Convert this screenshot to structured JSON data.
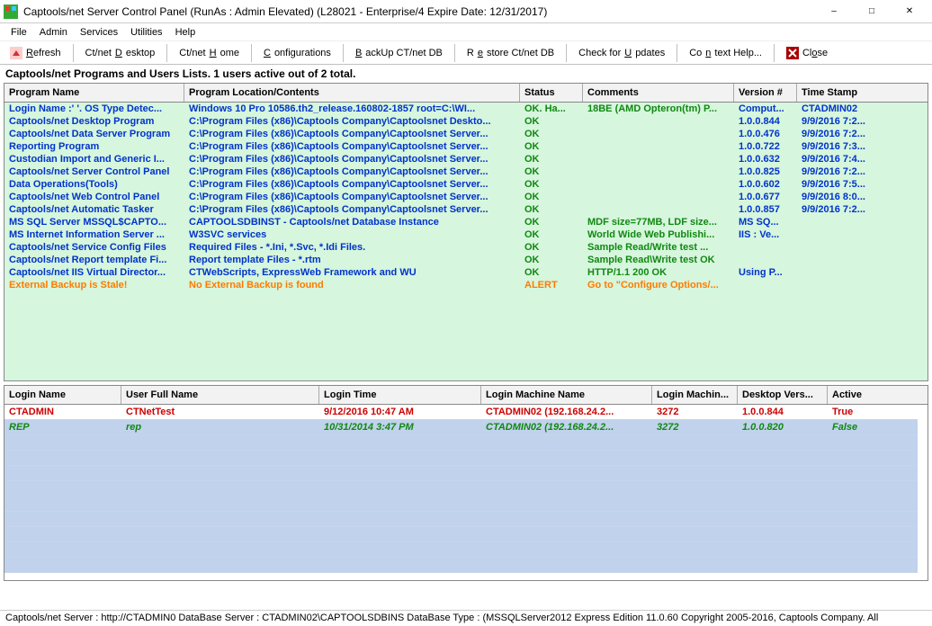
{
  "title": "Captools/net Server Control Panel (RunAs : Admin Elevated) (L28021 - Enterprise/4 Expire Date: 12/31/2017)",
  "menu": [
    "File",
    "Admin",
    "Services",
    "Utilities",
    "Help"
  ],
  "toolbar": {
    "refresh": "Refresh",
    "desktop": "Ct/net Desktop",
    "home": "Ct/net Home",
    "config": "Configurations",
    "backup": "BackUp CT/net DB",
    "restore": "Restore Ct/net DB",
    "updates": "Check for Updates",
    "context": "Context Help...",
    "close": "Close"
  },
  "subtitle": "Captools/net Programs and Users Lists. 1 users active out of 2 total.",
  "programs_head": {
    "name": "Program Name",
    "loc": "Program Location/Contents",
    "status": "Status",
    "comments": "Comments",
    "ver": "Version #",
    "time": "Time Stamp"
  },
  "programs": [
    {
      "n": "Login Name :' '. OS Type Detec...",
      "l": "Windows 10 Pro  10586.th2_release.160802-1857 root=C:\\WI...",
      "s": "OK.  Ha...",
      "c": "18BE (AMD Opteron(tm) P...",
      "v": "Comput...",
      "t": "CTADMIN02",
      "cls": "blue",
      "scls": "green"
    },
    {
      "n": "Captools/net Desktop Program",
      "l": "C:\\Program Files (x86)\\Captools Company\\Captoolsnet Deskto...",
      "s": "OK",
      "c": "",
      "v": "1.0.0.844",
      "t": "9/9/2016 7:2...",
      "cls": "blue",
      "scls": "green"
    },
    {
      "n": "Captools/net Data Server Program",
      "l": "C:\\Program Files (x86)\\Captools Company\\Captoolsnet Server...",
      "s": "OK",
      "c": "",
      "v": "1.0.0.476",
      "t": "9/9/2016 7:2...",
      "cls": "blue",
      "scls": "green"
    },
    {
      "n": "Reporting Program",
      "l": "C:\\Program Files (x86)\\Captools Company\\Captoolsnet Server...",
      "s": "OK",
      "c": "",
      "v": "1.0.0.722",
      "t": "9/9/2016 7:3...",
      "cls": "blue",
      "scls": "green"
    },
    {
      "n": "Custodian Import and Generic I...",
      "l": "C:\\Program Files (x86)\\Captools Company\\Captoolsnet Server...",
      "s": "OK",
      "c": "",
      "v": "1.0.0.632",
      "t": "9/9/2016 7:4...",
      "cls": "blue",
      "scls": "green"
    },
    {
      "n": "Captools/net Server Control Panel",
      "l": "C:\\Program Files (x86)\\Captools Company\\Captoolsnet Server...",
      "s": "OK",
      "c": "",
      "v": "1.0.0.825",
      "t": "9/9/2016 7:2...",
      "cls": "blue",
      "scls": "green"
    },
    {
      "n": "Data Operations(Tools)",
      "l": "C:\\Program Files (x86)\\Captools Company\\Captoolsnet Server...",
      "s": "OK",
      "c": "",
      "v": "1.0.0.602",
      "t": "9/9/2016 7:5...",
      "cls": "blue",
      "scls": "green"
    },
    {
      "n": "Captools/net Web Control Panel",
      "l": "C:\\Program Files (x86)\\Captools Company\\Captoolsnet Server...",
      "s": "OK",
      "c": "",
      "v": "1.0.0.677",
      "t": "9/9/2016 8:0...",
      "cls": "blue",
      "scls": "green"
    },
    {
      "n": "Captools/net Automatic Tasker",
      "l": "C:\\Program Files (x86)\\Captools Company\\Captoolsnet Server...",
      "s": "OK",
      "c": "",
      "v": "1.0.0.857",
      "t": "9/9/2016 7:2...",
      "cls": "blue",
      "scls": "green"
    },
    {
      "n": "MS SQL Server MSSQL$CAPTO...",
      "l": "CAPTOOLSDBINST - Captools/net Database Instance",
      "s": "OK",
      "c": "MDF size=77MB, LDF size...",
      "v": "MS SQ...",
      "t": "",
      "cls": "blue",
      "scls": "green"
    },
    {
      "n": "MS Internet Information Server ...",
      "l": "W3SVC services",
      "s": "OK",
      "c": "World Wide Web Publishi...",
      "v": "IIS : Ve...",
      "t": "",
      "cls": "blue",
      "scls": "green"
    },
    {
      "n": "Captools/net Service Config Files",
      "l": "Required Files - *.Ini, *.Svc, *.Idi Files.",
      "s": "OK",
      "c": "Sample Read/Write test ...",
      "v": "",
      "t": "",
      "cls": "blue",
      "scls": "green"
    },
    {
      "n": "Captools/net Report template Fi...",
      "l": "Report template Files - *.rtm",
      "s": "OK",
      "c": "Sample Read\\Write test OK",
      "v": "",
      "t": "",
      "cls": "blue",
      "scls": "green"
    },
    {
      "n": "Captools/net IIS Virtual Director...",
      "l": "CTWebScripts, ExpressWeb Framework and WU",
      "s": "OK",
      "c": "HTTP/1.1 200 OK",
      "v": "Using P...",
      "t": "",
      "cls": "blue",
      "scls": "green"
    },
    {
      "n": "External Backup is Stale!",
      "l": "No External Backup is found",
      "s": "ALERT",
      "c": "Go to \"Configure Options/...",
      "v": "",
      "t": "",
      "cls": "orange",
      "scls": "orange"
    }
  ],
  "users_head": {
    "login": "Login Name",
    "name": "User Full Name",
    "time": "Login Time",
    "mach": "Login Machine Name",
    "port": "Login Machin...",
    "desk": "Desktop Vers...",
    "act": "Active"
  },
  "users": [
    {
      "login": "CTADMIN",
      "name": "CTNetTest",
      "time": "9/12/2016 10:47 AM",
      "mach": "CTADMIN02 (192.168.24.2...",
      "port": "3272",
      "desk": "1.0.0.844",
      "act": "True",
      "cls": "red"
    },
    {
      "login": "REP",
      "name": "rep",
      "time": "10/31/2014 3:47 PM",
      "mach": "CTADMIN02 (192.168.24.2...",
      "port": "3272",
      "desk": "1.0.0.820",
      "act": "False",
      "cls": "it-green"
    }
  ],
  "status": "Captools/net Server : http://CTADMIN0 DataBase Server : CTADMIN02\\CAPTOOLSDBINS DataBase Type : (MSSQLServer2012 Express Edition 11.0.60 Copyright 2005-2016, Captools Company. All"
}
